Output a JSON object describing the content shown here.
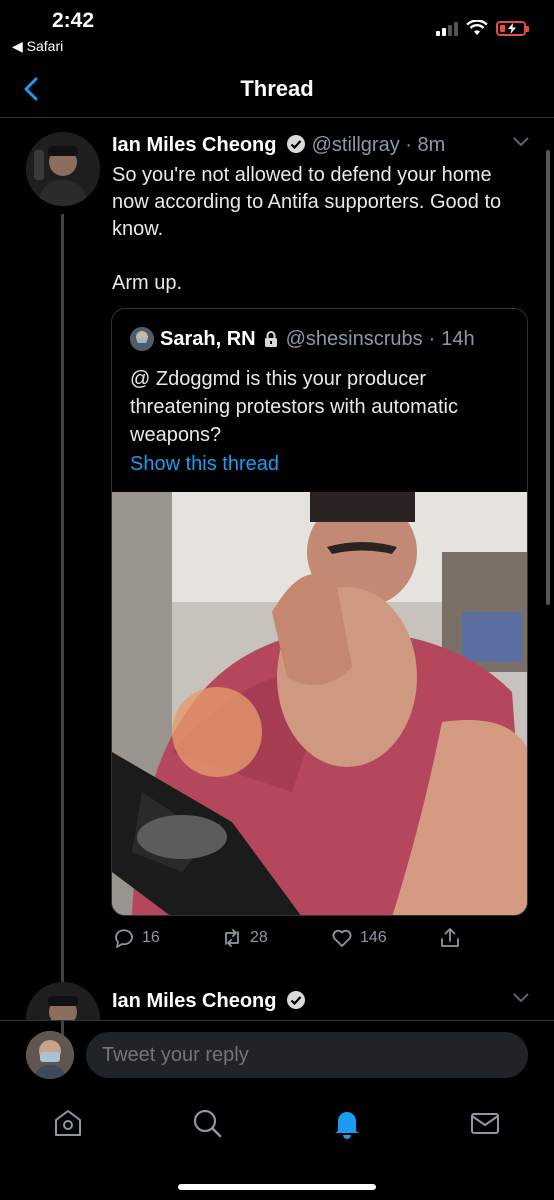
{
  "status_bar": {
    "time": "2:42",
    "back_app": "◀ Safari",
    "battery_color": "#e74c3c"
  },
  "header": {
    "title": "Thread"
  },
  "tweet": {
    "author_name": "Ian Miles Cheong",
    "handle": "@stillgray",
    "separator": "·",
    "time": "8m",
    "verified": true,
    "body_lines": [
      "So you're not allowed to defend your home now according to Antifa supporters. Good to know.",
      "Arm up."
    ],
    "quoted": {
      "author_name": "Sarah, RN",
      "protected": true,
      "handle": "@shesinscrubs",
      "time": "14h",
      "text": "@ Zdoggmd is this your producer threatening protestors with automatic weapons?",
      "show_thread": "Show this thread",
      "media_icon": "video-thumbnail"
    },
    "actions": {
      "replies": "16",
      "retweets": "28",
      "likes": "146"
    }
  },
  "next_tweet": {
    "author_name": "Ian Miles Cheong",
    "verified": true
  },
  "reply": {
    "placeholder": "Tweet your reply"
  },
  "tabs": [
    {
      "name": "home",
      "icon": "home-icon",
      "active": false
    },
    {
      "name": "search",
      "icon": "search-icon",
      "active": false
    },
    {
      "name": "notifications",
      "icon": "bell-icon",
      "active": true
    },
    {
      "name": "messages",
      "icon": "mail-icon",
      "active": false
    }
  ],
  "colors": {
    "accent": "#1d9bf0",
    "muted": "#8b98a5",
    "background": "#000000"
  }
}
